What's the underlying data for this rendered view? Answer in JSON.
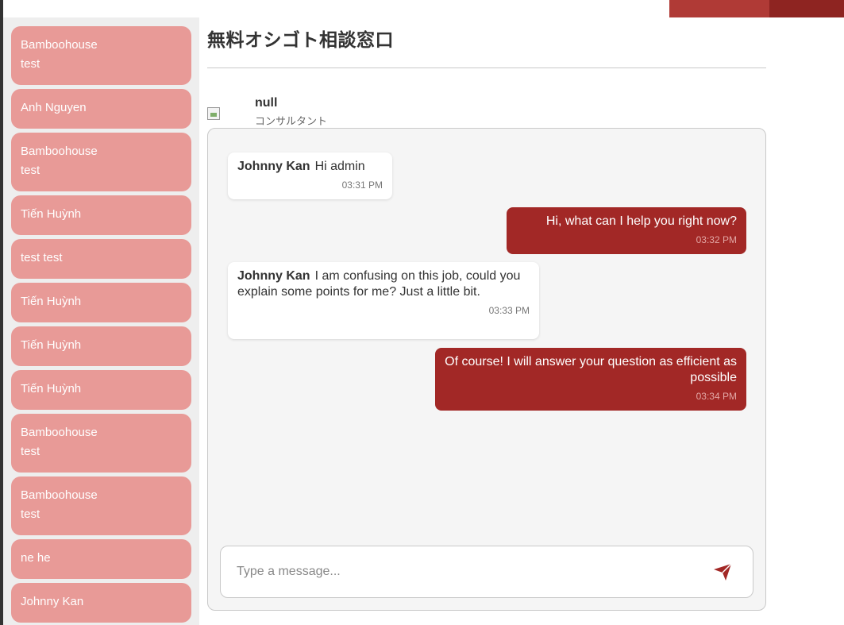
{
  "accent_color": "#a22826",
  "contacts": [
    {
      "name": "Bamboohouse\ntest"
    },
    {
      "name": "Anh Nguyen"
    },
    {
      "name": "Bamboohouse\ntest"
    },
    {
      "name": "Tiến Huỳnh"
    },
    {
      "name": "test test"
    },
    {
      "name": "Tiến Huỳnh"
    },
    {
      "name": "Tiến Huỳnh"
    },
    {
      "name": "Tiến Huỳnh"
    },
    {
      "name": "Bamboohouse\ntest"
    },
    {
      "name": "Bamboohouse\ntest"
    },
    {
      "name": "ne he"
    },
    {
      "name": "Johnny Kan"
    }
  ],
  "header": {
    "title": "無料オシゴト相談窓口"
  },
  "consultant": {
    "name": "null",
    "role": "コンサルタント"
  },
  "messages": [
    {
      "direction": "in",
      "sender": "Johnny Kan",
      "text": "Hi admin",
      "time": "03:31 PM"
    },
    {
      "direction": "out",
      "text": "Hi, what can I help you right now?",
      "time": "03:32 PM"
    },
    {
      "direction": "in",
      "sender": "Johnny Kan",
      "text": "I am confusing on this job, could you explain some points for me? Just a little bit.",
      "time": "03:33 PM"
    },
    {
      "direction": "out",
      "text": "Of course! I will answer your question as efficient as possible",
      "time": "03:34 PM"
    }
  ],
  "composer": {
    "placeholder": "Type a message...",
    "send_icon": "send-icon"
  }
}
